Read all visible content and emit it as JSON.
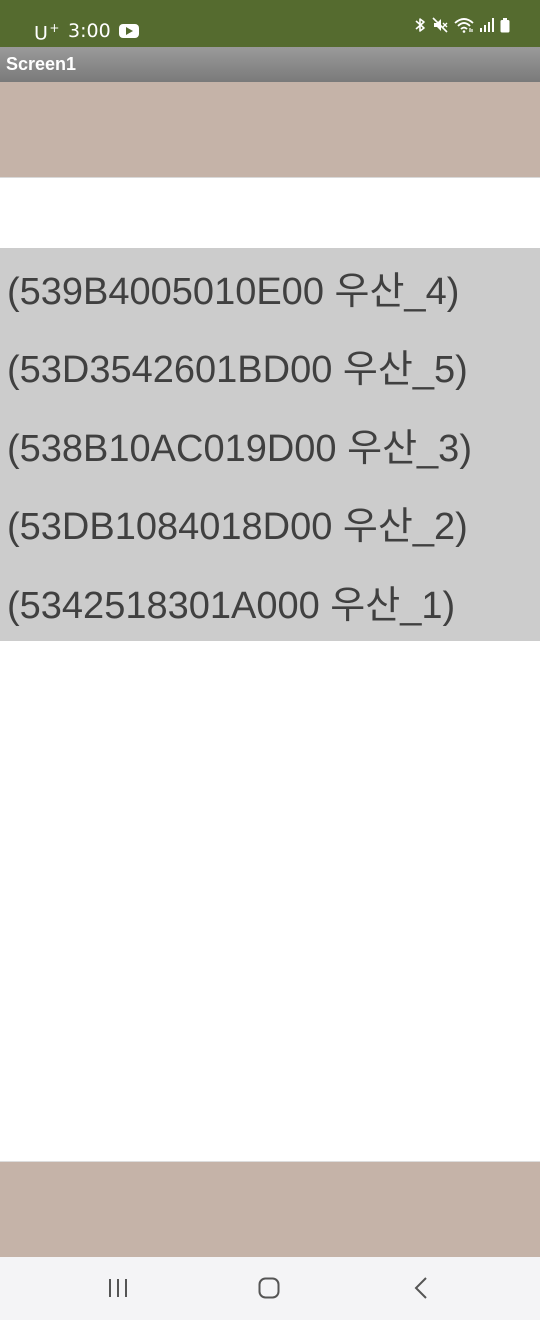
{
  "status_bar": {
    "carrier": "U",
    "carrier_plus": "+",
    "time": "3:00",
    "icons": [
      "youtube-icon",
      "bluetooth-icon",
      "mute-icon",
      "wifi-icon",
      "signal-icon",
      "battery-icon"
    ]
  },
  "app": {
    "title": "Screen1"
  },
  "colors": {
    "status_bar_bg": "#556b2f",
    "title_bar_bg": "#8a8a8a",
    "band_bg": "#c5b3a8",
    "list_bg": "#cccccc",
    "list_text": "#404040",
    "nav_bg": "#f4f4f6"
  },
  "list": {
    "items": [
      "(539B4005010E00 우산_4)",
      "(53D3542601BD00 우산_5)",
      "(538B10AC019D00 우산_3)",
      "(53DB1084018D00 우산_2)",
      "(5342518301A000 우산_1)"
    ]
  },
  "nav": {
    "icons": [
      "recent-apps-icon",
      "home-icon",
      "back-icon"
    ]
  }
}
